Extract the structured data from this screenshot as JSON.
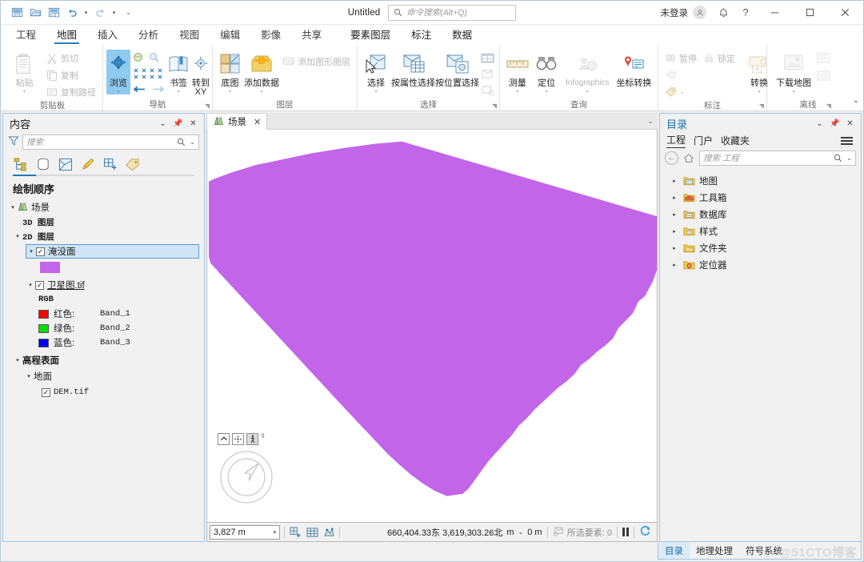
{
  "titlebar": {
    "document_title": "Untitled",
    "search_placeholder": "命令搜索(Alt+Q)",
    "search_icon": "search-icon",
    "account_label": "未登录",
    "avatar_icon": "user-icon",
    "notification_icon": "bell-icon",
    "help_icon": "question-icon",
    "minimize_icon": "minimize-icon",
    "maximize_icon": "maximize-icon",
    "close_icon": "close-icon",
    "qat": [
      {
        "name": "save-project-icon"
      },
      {
        "name": "open-project-icon"
      },
      {
        "name": "save-as-icon"
      },
      {
        "name": "undo-icon"
      },
      {
        "name": "redo-icon"
      },
      {
        "name": "customize-qat-icon"
      }
    ]
  },
  "ribbon": {
    "tabs": [
      {
        "label": "工程",
        "active": false
      },
      {
        "label": "地图",
        "active": true
      },
      {
        "label": "插入",
        "active": false
      },
      {
        "label": "分析",
        "active": false
      },
      {
        "label": "视图",
        "active": false
      },
      {
        "label": "编辑",
        "active": false
      },
      {
        "label": "影像",
        "active": false
      },
      {
        "label": "共享",
        "active": false
      }
    ],
    "contextual_tabs": [
      {
        "label": "要素图层",
        "active": true
      },
      {
        "label": "标注",
        "active": false
      },
      {
        "label": "数据",
        "active": false
      }
    ],
    "groups": [
      {
        "title": "剪贴板",
        "big": [
          {
            "label": "粘贴",
            "icon": "paste-icon",
            "disabled": true,
            "dropdown": true
          }
        ],
        "small": [
          {
            "label": "剪切",
            "icon": "cut-icon",
            "disabled": true
          },
          {
            "label": "复制",
            "icon": "copy-icon",
            "disabled": true
          },
          {
            "label": "复制路径",
            "icon": "copy-path-icon",
            "disabled": true
          }
        ]
      },
      {
        "title": "导航",
        "dialog_launcher": true,
        "big": [
          {
            "label": "浏览",
            "icon": "explore-icon",
            "active": true,
            "dropdown": true
          },
          {
            "label": "书签",
            "icon": "bookmark-icon",
            "dropdown": true
          },
          {
            "label": "转到",
            "label2": "XY",
            "icon": "go-to-xy-icon"
          }
        ],
        "mini": [
          {
            "name": "full-extent-icon"
          },
          {
            "name": "fixed-zoom-in-icon"
          },
          {
            "name": "previous-extent-icon"
          },
          {
            "name": "next-extent-icon"
          }
        ]
      },
      {
        "title": "图层",
        "big": [
          {
            "label": "底图",
            "icon": "basemap-icon",
            "dropdown": true
          },
          {
            "label": "添加数据",
            "icon": "add-data-icon",
            "dropdown": true
          }
        ],
        "small": [
          {
            "label": "添加图形图层",
            "icon": "add-graphics-layer-icon",
            "disabled": true
          }
        ]
      },
      {
        "title": "选择",
        "dialog_launcher": true,
        "big": [
          {
            "label": "选择",
            "icon": "select-icon",
            "dropdown": true
          },
          {
            "label": "按属性选择",
            "icon": "select-by-attributes-icon"
          },
          {
            "label": "按位置选择",
            "icon": "select-by-location-icon"
          }
        ],
        "mini": [
          {
            "name": "attribute-table-icon"
          },
          {
            "name": "zoom-to-selection-icon"
          },
          {
            "name": "clear-selection-icon"
          }
        ]
      },
      {
        "title": "查询",
        "big": [
          {
            "label": "测量",
            "icon": "measure-icon",
            "dropdown": true
          },
          {
            "label": "定位",
            "icon": "locate-icon",
            "dropdown": true
          },
          {
            "label": "Infographics",
            "icon": "infographics-icon",
            "disabled": true,
            "dropdown": true
          },
          {
            "label": "坐标转换",
            "icon": "coordinate-conversion-icon"
          }
        ]
      },
      {
        "title": "标注",
        "dialog_launcher": true,
        "small": [
          {
            "label": "暂停",
            "icon": "pause-labeling-icon",
            "disabled": true
          },
          {
            "label": "锁定",
            "icon": "lock-labeling-icon",
            "disabled": true
          },
          {
            "label": "",
            "icon": "label-more-icon",
            "disabled": true
          }
        ],
        "big": [
          {
            "label": "转换",
            "icon": "convert-labels-icon",
            "disabled": true,
            "dropdown": true
          }
        ]
      },
      {
        "title": "离线",
        "dialog_launcher": true,
        "big": [
          {
            "label": "下载地图",
            "icon": "download-map-icon",
            "disabled": true,
            "dropdown": true
          }
        ],
        "mini": [
          {
            "name": "sync-icon"
          },
          {
            "name": "manage-replica-icon"
          }
        ]
      }
    ],
    "collapse_icon": "collapse-ribbon-icon"
  },
  "contents": {
    "title": "内容",
    "panel_controls": [
      "menu-caret-icon",
      "pin-icon",
      "close-icon"
    ],
    "filter_icon": "filter-icon",
    "search_placeholder": "搜索",
    "search_icon": "search-icon",
    "search_caret": "chevron-down-icon",
    "tabs": [
      {
        "name": "drawing-order-tab",
        "icon": "list-by-drawing-order-icon",
        "active": true
      },
      {
        "name": "data-source-tab",
        "icon": "list-by-data-source-icon"
      },
      {
        "name": "selection-tab",
        "icon": "list-by-selection-icon"
      },
      {
        "name": "editing-tab",
        "icon": "list-by-editing-icon"
      },
      {
        "name": "snapping-tab",
        "icon": "list-by-snapping-icon"
      },
      {
        "name": "labeling-tab",
        "icon": "list-by-labeling-icon"
      }
    ],
    "heading": "绘制顺序",
    "tree": {
      "scene_label": "场景",
      "scene_icon": "scene-icon",
      "layers_3d": "3D 图层",
      "layers_2d": "2D 图层",
      "flood_layer": {
        "label": "淹没面",
        "checked": true,
        "selected": true,
        "swatch_color": "#c265e8"
      },
      "satellite_layer": {
        "label": "卫星图.tif",
        "checked": true,
        "renderer": "RGB",
        "bands": [
          {
            "color_label": "红色:",
            "band": "Band_1",
            "color": "#ff0000"
          },
          {
            "color_label": "绿色:",
            "band": "Band_2",
            "color": "#00e000"
          },
          {
            "color_label": "蓝色:",
            "band": "Band_3",
            "color": "#0000ff"
          }
        ]
      },
      "elevation_surfaces": "高程表面",
      "ground": "地面",
      "dem_layer": {
        "label": "DEM.tif",
        "checked": true
      }
    }
  },
  "mapview": {
    "tab_label": "场景",
    "tab_icon": "scene-icon",
    "tab_close_icon": "close-icon",
    "tabs_caret_icon": "chevron-down-icon",
    "polygon_color": "#c265e8",
    "background_color": "#ffffff",
    "nav_tools": [
      {
        "name": "collapse-nav-icon",
        "glyph": "⌃"
      },
      {
        "name": "pan-nav-icon",
        "glyph": "✥"
      },
      {
        "name": "walk-nav-icon",
        "glyph": "🚶",
        "pressed": true
      }
    ],
    "nav_dots_icon": "full-control-nav-icon",
    "compass_icon": "on-screen-navigator-icon"
  },
  "statusbar": {
    "scale": "3,827 m",
    "scale_caret": "chevron-down-icon",
    "icons": [
      {
        "name": "add-grid-icon"
      },
      {
        "name": "show-grid-icon"
      },
      {
        "name": "exploratory-analysis-icon"
      }
    ],
    "coordinates": "660,404.33东 3,619,303.26北",
    "coord_unit": "m",
    "coord_caret": "chevron-down-icon",
    "elevation": "0 m",
    "selection_icon": "selected-features-icon",
    "selection_label": "所选要素: 0",
    "pause_icon": "pause-drawing-icon",
    "refresh_icon": "refresh-icon"
  },
  "catalog": {
    "title": "目录",
    "panel_controls": [
      "menu-caret-icon",
      "pin-icon",
      "close-icon"
    ],
    "tabs": [
      {
        "label": "工程",
        "active": true
      },
      {
        "label": "门户",
        "active": false
      },
      {
        "label": "收藏夹",
        "active": false
      }
    ],
    "menu_icon": "hamburger-menu-icon",
    "back_icon": "back-arrow-icon",
    "home_icon": "home-icon",
    "search_placeholder": "搜索 工程",
    "search_icon": "search-icon",
    "search_caret": "chevron-down-icon",
    "items": [
      {
        "label": "地图",
        "icon": "maps-folder-icon",
        "color": "#e8c14a"
      },
      {
        "label": "工具箱",
        "icon": "toolboxes-folder-icon",
        "color": "#e8a33d"
      },
      {
        "label": "数据库",
        "icon": "databases-folder-icon",
        "color": "#e8c14a"
      },
      {
        "label": "样式",
        "icon": "styles-folder-icon",
        "color": "#e8c14a"
      },
      {
        "label": "文件夹",
        "icon": "folders-icon",
        "color": "#e8b44a"
      },
      {
        "label": "定位器",
        "icon": "locators-folder-icon",
        "color": "#e8c14a"
      }
    ]
  },
  "dock_tabs": [
    {
      "label": "目录",
      "active": true
    },
    {
      "label": "地理处理",
      "active": false
    },
    {
      "label": "符号系统",
      "active": false
    }
  ],
  "watermark": "@51CTO博客"
}
